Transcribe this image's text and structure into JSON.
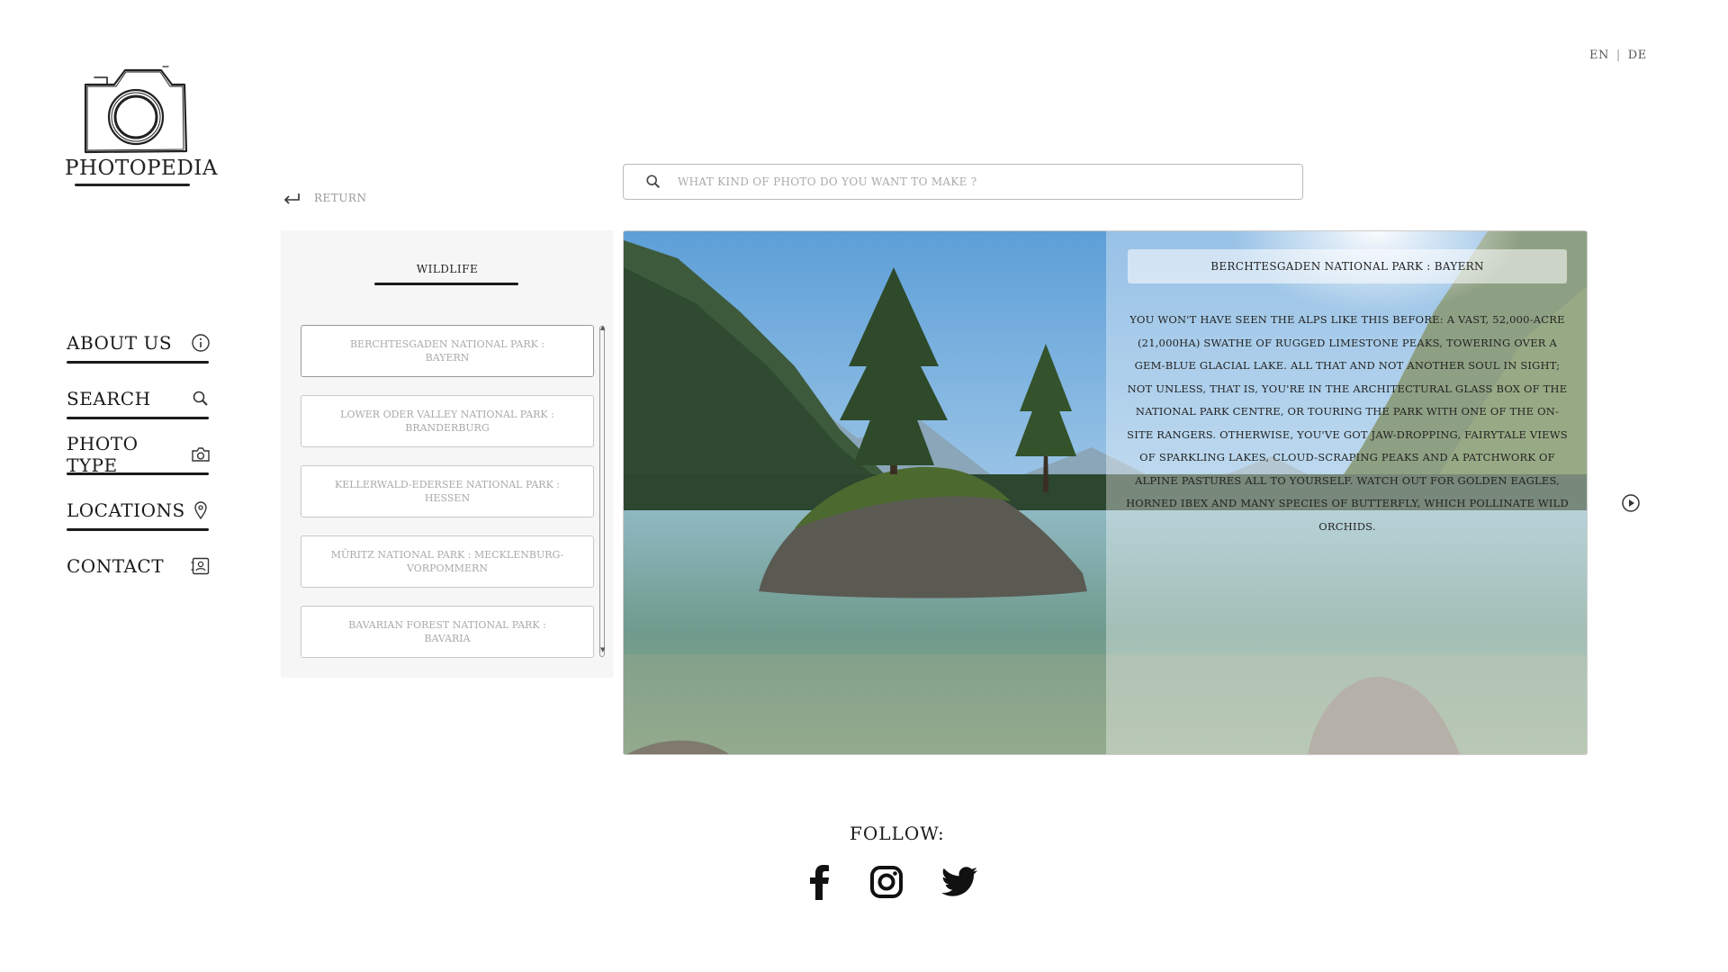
{
  "lang": {
    "en": "EN",
    "separator": "|",
    "de": "DE"
  },
  "logo": {
    "title": "PHOTOPEDIA"
  },
  "nav": {
    "items": [
      {
        "label": "ABOUT US",
        "icon": "info-icon"
      },
      {
        "label": "SEARCH",
        "icon": "search-icon"
      },
      {
        "label": "PHOTO TYPE",
        "icon": "camera-icon"
      },
      {
        "label": "LOCATIONS",
        "icon": "location-pin-icon"
      },
      {
        "label": "CONTACT",
        "icon": "contact-card-icon"
      }
    ]
  },
  "return_label": "RETURN",
  "search": {
    "placeholder": "WHAT KIND OF PHOTO DO YOU WANT TO MAKE ?"
  },
  "category": {
    "title": "WILDLIFE",
    "parks": [
      "BERCHTESGADEN NATIONAL PARK : BAYERN",
      "LOWER ODER VALLEY NATIONAL PARK : BRANDERBURG",
      "KELLERWALD-EDERSEE NATIONAL PARK : HESSEN",
      "MÜRITZ NATIONAL PARK : MECKLENBURG-VORPOMMERN",
      "BAVARIAN FOREST NATIONAL PARK : BAVARIA"
    ]
  },
  "detail": {
    "title": "BERCHTESGADEN NATIONAL PARK : BAYERN",
    "description": "You won't have seen the Alps like this before: a vast, 52,000-acre (21,000ha) swathe of rugged limestone peaks, towering over a gem-blue glacial lake. All that and not another soul in sight; not unless, that is, you're in the architectural glass box of the national park centre, or touring the park with one of the on-site rangers. Otherwise, you've got jaw-dropping, fairytale views of sparkling lakes, cloud-scraping peaks and a patchwork of alpine pastures all to yourself. Watch out for golden eagles, horned ibex and many species of butterfly, which pollinate wild orchids."
  },
  "footer": {
    "follow_label": "FOLLOW:",
    "socials": [
      "facebook-icon",
      "instagram-icon",
      "twitter-icon"
    ]
  }
}
